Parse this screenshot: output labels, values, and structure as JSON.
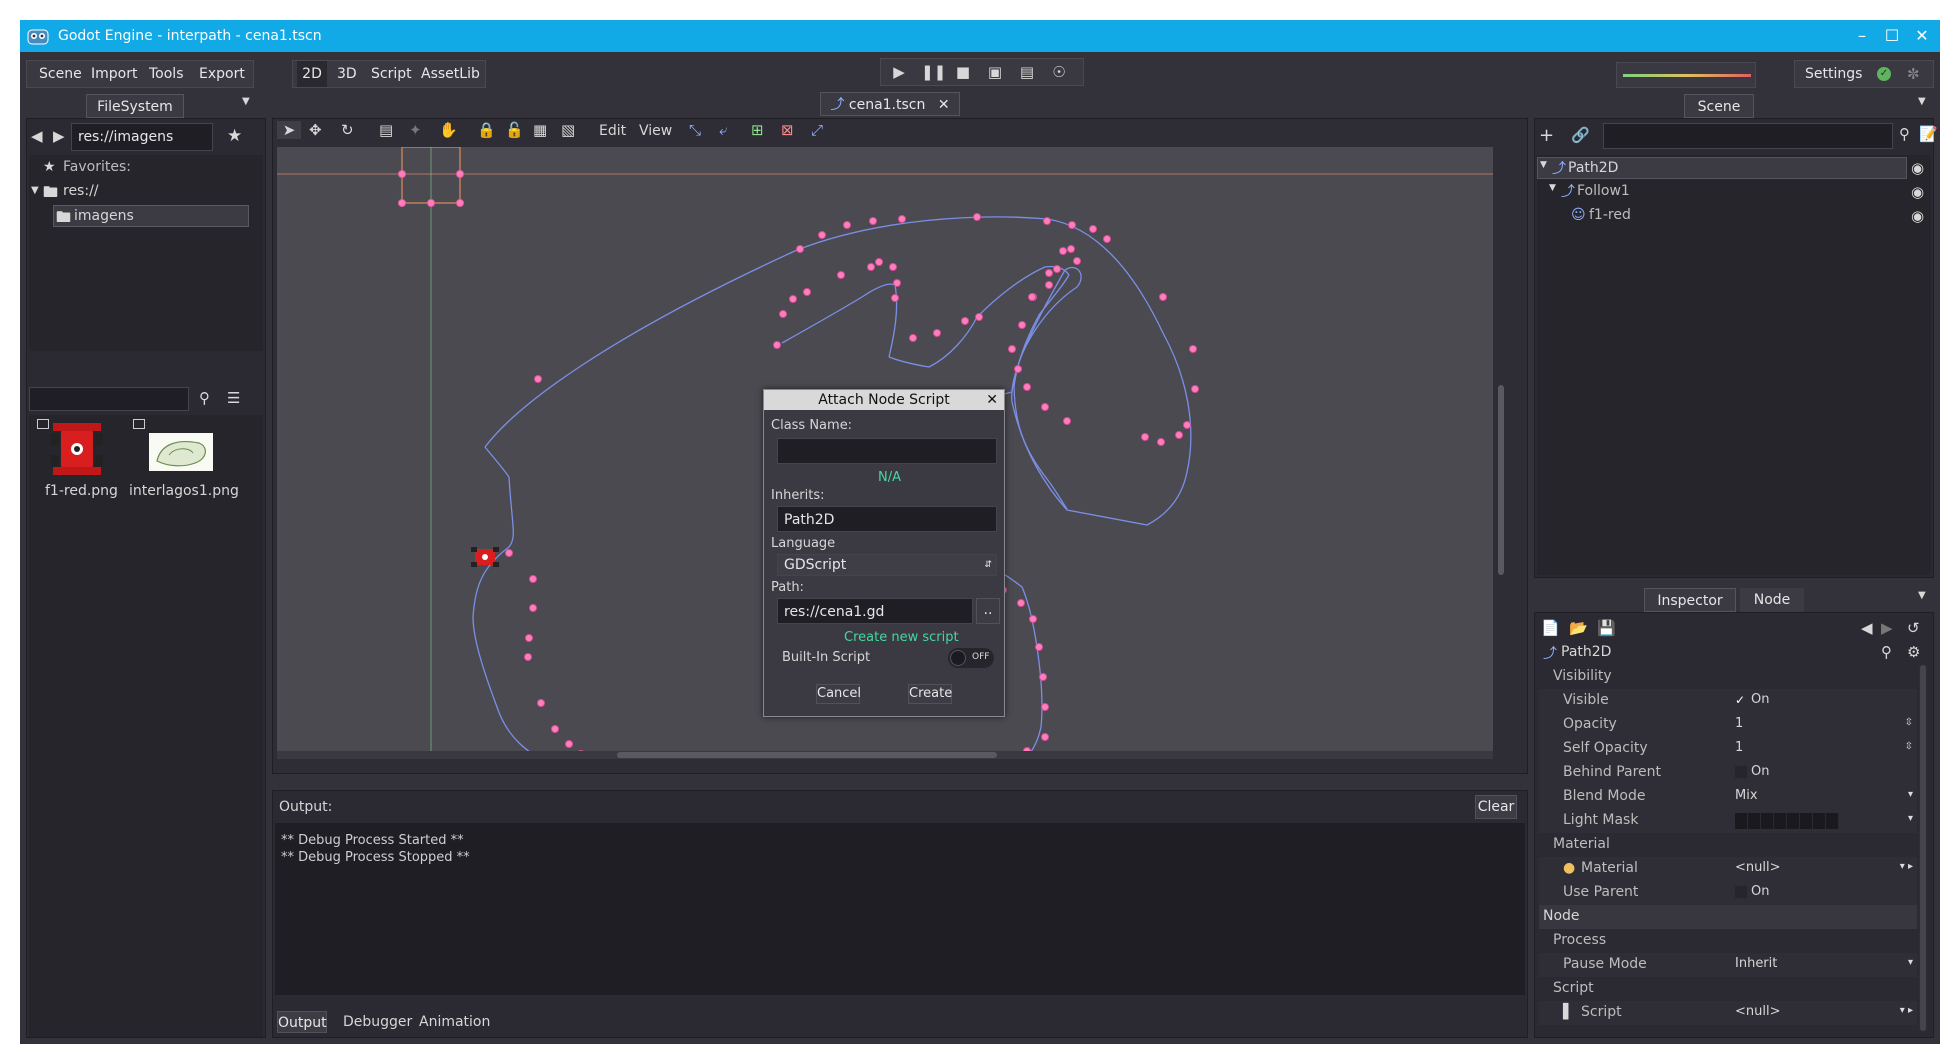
{
  "window": {
    "title": "Godot Engine - interpath - cena1.tscn"
  },
  "menu": {
    "scene": "Scene",
    "import": "Import",
    "tools": "Tools",
    "export": "Export"
  },
  "workspaces": {
    "w2d": "2D",
    "w3d": "3D",
    "script": "Script",
    "assetlib": "AssetLib"
  },
  "settings": "Settings",
  "filesystem": {
    "tab": "FileSystem",
    "path": "res://imagens",
    "favorites": "Favorites:",
    "root": "res://",
    "folder": "imagens",
    "files": [
      "f1-red.png",
      "interlagos1.png"
    ]
  },
  "scene_tab": "cena1.tscn",
  "viewport_menu": {
    "edit": "Edit",
    "view": "View"
  },
  "dialog": {
    "title": "Attach Node Script",
    "class_name_label": "Class Name:",
    "class_name_value": "",
    "na": "N/A",
    "inherits_label": "Inherits:",
    "inherits_value": "Path2D",
    "language_label": "Language",
    "language_value": "GDScript",
    "path_label": "Path:",
    "path_value": "res://cena1.gd",
    "browse": "..",
    "create_new": "Create new script",
    "builtin_label": "Built-In Script",
    "builtin_state": "OFF",
    "cancel": "Cancel",
    "create": "Create"
  },
  "output": {
    "label": "Output:",
    "clear": "Clear",
    "lines": [
      "** Debug Process Started **",
      "** Debug Process Stopped **"
    ],
    "tabs": [
      "Output",
      "Debugger",
      "Animation"
    ]
  },
  "scene_dock": {
    "tab": "Scene",
    "tree": [
      {
        "name": "Path2D",
        "depth": 0
      },
      {
        "name": "Follow1",
        "depth": 1
      },
      {
        "name": "f1-red",
        "depth": 2
      }
    ]
  },
  "inspector": {
    "tab_inspector": "Inspector",
    "tab_node": "Node",
    "object": "Path2D",
    "rows": [
      {
        "type": "section",
        "label": "Visibility",
        "indent": 1
      },
      {
        "type": "prop",
        "label": "Visible",
        "value": "On",
        "check": true
      },
      {
        "type": "prop",
        "label": "Opacity",
        "value": "1",
        "spin": true
      },
      {
        "type": "prop",
        "label": "Self Opacity",
        "value": "1",
        "spin": true
      },
      {
        "type": "prop",
        "label": "Behind Parent",
        "value": "On",
        "check": false
      },
      {
        "type": "prop",
        "label": "Blend Mode",
        "value": "Mix",
        "drop": true
      },
      {
        "type": "prop",
        "label": "Light Mask",
        "value": "",
        "mask": true
      },
      {
        "type": "section",
        "label": "Material",
        "indent": 1
      },
      {
        "type": "prop",
        "label": "Material",
        "value": "<null>",
        "res": true,
        "icon": "material-icon"
      },
      {
        "type": "prop",
        "label": "Use Parent",
        "value": "On",
        "check": false
      },
      {
        "type": "header",
        "label": "Node"
      },
      {
        "type": "section",
        "label": "Process",
        "indent": 1
      },
      {
        "type": "prop",
        "label": "Pause Mode",
        "value": "Inherit",
        "drop": true
      },
      {
        "type": "section",
        "label": "Script",
        "indent": 1
      },
      {
        "type": "prop",
        "label": "Script",
        "value": "<null>",
        "res": true,
        "icon": "script-icon"
      }
    ]
  },
  "colors": {
    "accent": "#11a9e6",
    "path_line": "#7b8fe6",
    "path_point": "#ff7fbd",
    "green_text": "#45d7a0"
  }
}
